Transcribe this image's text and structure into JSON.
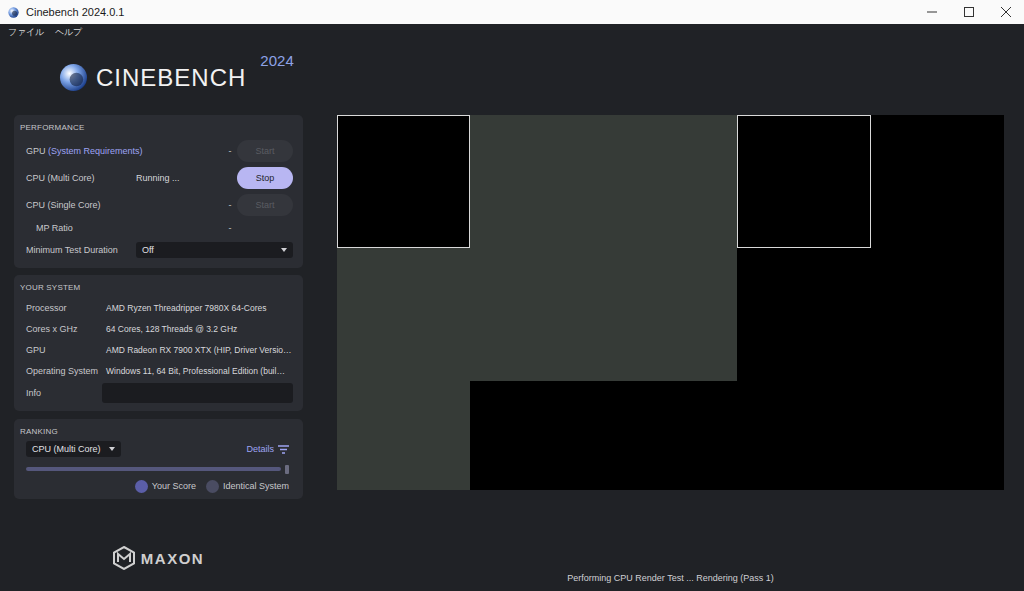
{
  "window": {
    "title": "Cinebench 2024.0.1"
  },
  "menu": [
    {
      "label": "ファイル"
    },
    {
      "label": "ヘルプ"
    }
  ],
  "logo": {
    "name": "CINEBENCH",
    "year": "2024"
  },
  "performance": {
    "title": "PERFORMANCE",
    "tests": [
      {
        "label": "GPU",
        "link": "(System Requirements)",
        "status": "-",
        "button": "Start",
        "running": false,
        "disabled": true
      },
      {
        "label": "CPU (Multi Core)",
        "link": "",
        "status": "Running ...",
        "button": "Stop",
        "running": true,
        "disabled": false
      },
      {
        "label": "CPU (Single Core)",
        "link": "",
        "status": "-",
        "button": "Start",
        "running": false,
        "disabled": true
      }
    ],
    "mp_ratio": {
      "label": "MP Ratio",
      "value": "-"
    },
    "min_duration": {
      "label": "Minimum Test Duration",
      "value": "Off"
    }
  },
  "system": {
    "title": "YOUR SYSTEM",
    "rows": [
      {
        "label": "Processor",
        "value": "AMD Ryzen Threadripper 7980X 64-Cores"
      },
      {
        "label": "Cores x GHz",
        "value": "64 Cores, 128 Threads @ 3.2 GHz"
      },
      {
        "label": "GPU",
        "value": "AMD Radeon RX 7900 XTX (HIP, Driver Versio…"
      },
      {
        "label": "Operating System",
        "value": "Windows 11, 64 Bit, Professional Edition (buil…"
      }
    ],
    "info": {
      "label": "Info",
      "value": ""
    }
  },
  "ranking": {
    "title": "RANKING",
    "select": "CPU (Multi Core)",
    "details": "Details",
    "level": 1,
    "legend": [
      {
        "label": "Your Score",
        "color": "#5b5ea8"
      },
      {
        "label": "Identical System",
        "color": "#4a4c62"
      }
    ]
  },
  "brand": "MAXON",
  "render": {
    "rows": [
      [
        {
          "rendered": false,
          "active": true
        },
        {
          "rendered": true,
          "active": false
        },
        {
          "rendered": true,
          "active": false
        },
        {
          "rendered": false,
          "active": true
        },
        {
          "rendered": false,
          "active": false
        }
      ],
      [
        {
          "rendered": true,
          "active": false
        },
        {
          "rendered": true,
          "active": false
        },
        {
          "rendered": true,
          "active": false
        },
        {
          "rendered": false,
          "active": false
        },
        {
          "rendered": false,
          "active": false
        }
      ],
      [
        {
          "rendered": true,
          "active": false
        },
        {
          "rendered": false,
          "active": false
        },
        {
          "rendered": false,
          "active": false
        },
        {
          "rendered": false,
          "active": false
        },
        {
          "rendered": false,
          "active": false
        }
      ]
    ]
  },
  "status": "Performing CPU Render Test ... Rendering (Pass 1)"
}
